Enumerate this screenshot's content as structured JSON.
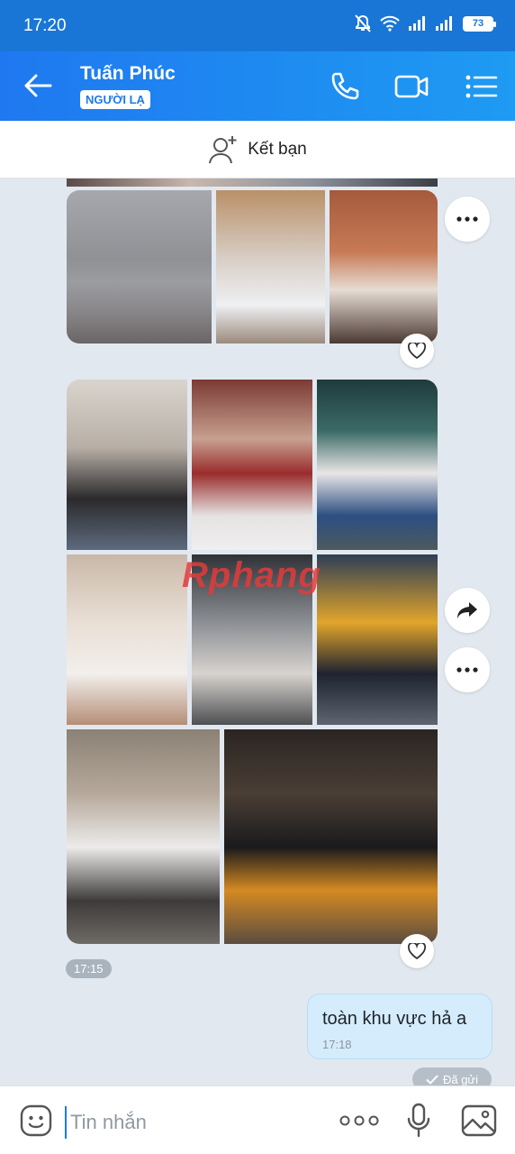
{
  "status_bar": {
    "time": "17:20",
    "battery": "73"
  },
  "header": {
    "contact_name": "Tuấn Phúc",
    "badge": "NGƯỜI LẠ"
  },
  "friend_bar": {
    "label": "Kết bạn"
  },
  "chat": {
    "watermark": "Rphang",
    "photo_time": "17:15",
    "sent_message": {
      "text": "toàn khu vực hả a",
      "time": "17:18",
      "status": "Đã gửi"
    }
  },
  "composer": {
    "placeholder": "Tin nhắn"
  }
}
